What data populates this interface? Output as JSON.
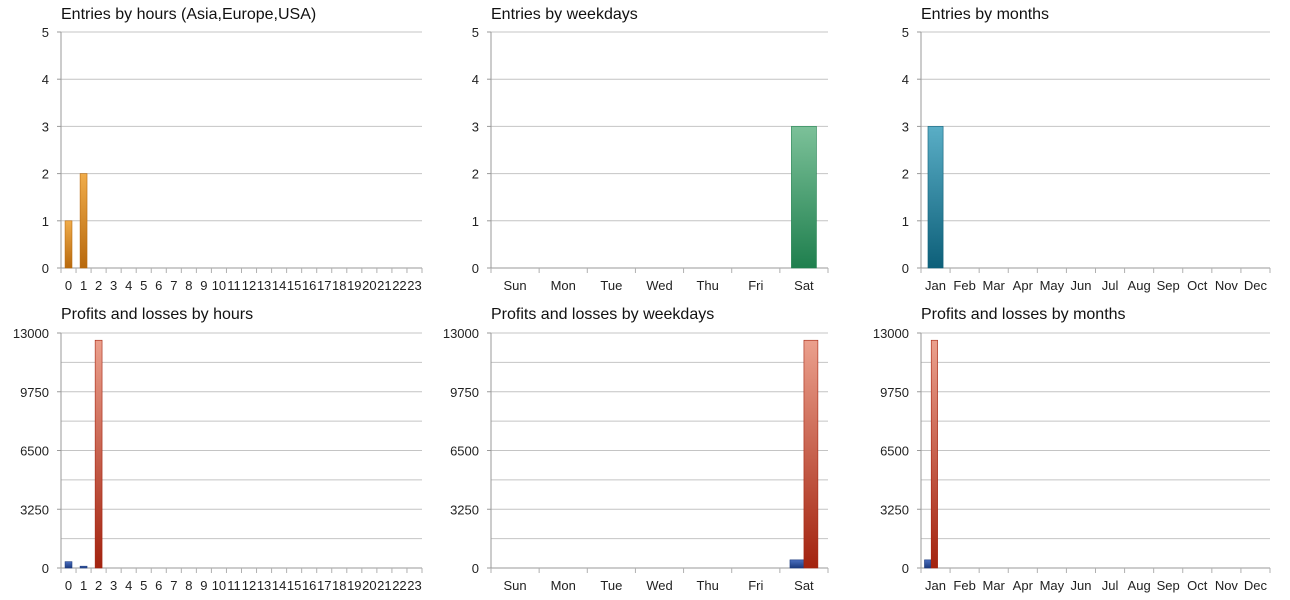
{
  "chart_data": [
    {
      "id": "entries-hours",
      "type": "bar",
      "title": "Entries by hours (Asia,Europe,USA)",
      "categories": [
        "0",
        "1",
        "2",
        "3",
        "4",
        "5",
        "6",
        "7",
        "8",
        "9",
        "10",
        "11",
        "12",
        "13",
        "14",
        "15",
        "16",
        "17",
        "18",
        "19",
        "20",
        "21",
        "22",
        "23"
      ],
      "series": [
        {
          "values": [
            1,
            2,
            0,
            0,
            0,
            0,
            0,
            0,
            0,
            0,
            0,
            0,
            0,
            0,
            0,
            0,
            0,
            0,
            0,
            0,
            0,
            0,
            0,
            0
          ],
          "color": "#d98c25",
          "color_light": "#f0ac4a",
          "color_dark": "#b8690d"
        }
      ],
      "ylim": [
        0,
        5
      ],
      "yticks": [
        "0",
        "1",
        "2",
        "3",
        "4",
        "5"
      ],
      "grid": true
    },
    {
      "id": "entries-weekdays",
      "type": "bar",
      "title": "Entries by weekdays",
      "categories": [
        "Sun",
        "Mon",
        "Tue",
        "Wed",
        "Thu",
        "Fri",
        "Sat"
      ],
      "series": [
        {
          "values": [
            0,
            0,
            0,
            0,
            0,
            0,
            3
          ],
          "color": "#4aa877",
          "color_light": "#7cc199",
          "color_dark": "#1f7f4e"
        }
      ],
      "ylim": [
        0,
        5
      ],
      "yticks": [
        "0",
        "1",
        "2",
        "3",
        "4",
        "5"
      ],
      "grid": true
    },
    {
      "id": "entries-months",
      "type": "bar",
      "title": "Entries by months",
      "categories": [
        "Jan",
        "Feb",
        "Mar",
        "Apr",
        "May",
        "Jun",
        "Jul",
        "Aug",
        "Sep",
        "Oct",
        "Nov",
        "Dec"
      ],
      "series": [
        {
          "values": [
            3,
            0,
            0,
            0,
            0,
            0,
            0,
            0,
            0,
            0,
            0,
            0
          ],
          "color": "#2f8fa8",
          "color_light": "#5aaec6",
          "color_dark": "#0d5f79"
        }
      ],
      "ylim": [
        0,
        5
      ],
      "yticks": [
        "0",
        "1",
        "2",
        "3",
        "4",
        "5"
      ],
      "grid": true
    },
    {
      "id": "pl-hours",
      "type": "bar",
      "title": "Profits and losses by hours",
      "categories": [
        "0",
        "1",
        "2",
        "3",
        "4",
        "5",
        "6",
        "7",
        "8",
        "9",
        "10",
        "11",
        "12",
        "13",
        "14",
        "15",
        "16",
        "17",
        "18",
        "19",
        "20",
        "21",
        "22",
        "23"
      ],
      "series": [
        {
          "values": [
            350,
            100,
            0,
            0,
            0,
            0,
            0,
            0,
            0,
            0,
            0,
            0,
            0,
            0,
            0,
            0,
            0,
            0,
            0,
            0,
            0,
            0,
            0,
            0
          ],
          "color": "#2b4f9e",
          "color_light": "#4a6fc0",
          "color_dark": "#1c3a7d"
        },
        {
          "values": [
            0,
            0,
            12600,
            0,
            0,
            0,
            0,
            0,
            0,
            0,
            0,
            0,
            0,
            0,
            0,
            0,
            0,
            0,
            0,
            0,
            0,
            0,
            0,
            0
          ],
          "color": "#c55a45",
          "color_light": "#eba08d",
          "color_dark": "#a3230f"
        }
      ],
      "ylim": [
        0,
        13000
      ],
      "yticks": [
        "0",
        "3250",
        "6500",
        "9750",
        "13000"
      ],
      "grid": true
    },
    {
      "id": "pl-weekdays",
      "type": "bar",
      "title": "Profits and losses by weekdays",
      "categories": [
        "Sun",
        "Mon",
        "Tue",
        "Wed",
        "Thu",
        "Fri",
        "Sat"
      ],
      "series": [
        {
          "values": [
            0,
            0,
            0,
            0,
            0,
            0,
            450
          ],
          "color": "#2b4f9e",
          "color_light": "#4a6fc0",
          "color_dark": "#1c3a7d"
        },
        {
          "values": [
            0,
            0,
            0,
            0,
            0,
            0,
            12600
          ],
          "color": "#c55a45",
          "color_light": "#eba08d",
          "color_dark": "#a3230f"
        }
      ],
      "ylim": [
        0,
        13000
      ],
      "yticks": [
        "0",
        "3250",
        "6500",
        "9750",
        "13000"
      ],
      "grid": true
    },
    {
      "id": "pl-months",
      "type": "bar",
      "title": "Profits and losses by months",
      "categories": [
        "Jan",
        "Feb",
        "Mar",
        "Apr",
        "May",
        "Jun",
        "Jul",
        "Aug",
        "Sep",
        "Oct",
        "Nov",
        "Dec"
      ],
      "series": [
        {
          "values": [
            450,
            0,
            0,
            0,
            0,
            0,
            0,
            0,
            0,
            0,
            0,
            0
          ],
          "color": "#2b4f9e",
          "color_light": "#4a6fc0",
          "color_dark": "#1c3a7d"
        },
        {
          "values": [
            12600,
            0,
            0,
            0,
            0,
            0,
            0,
            0,
            0,
            0,
            0,
            0
          ],
          "color": "#c55a45",
          "color_light": "#eba08d",
          "color_dark": "#a3230f"
        }
      ],
      "ylim": [
        0,
        13000
      ],
      "yticks": [
        "0",
        "3250",
        "6500",
        "9750",
        "13000"
      ],
      "grid": true
    }
  ]
}
